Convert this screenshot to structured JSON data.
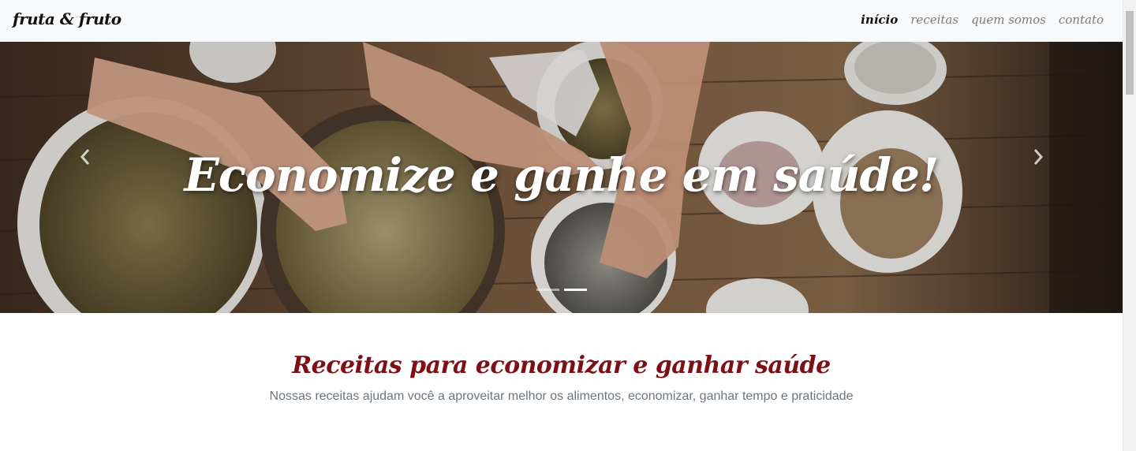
{
  "brand": {
    "name": "fruta & fruto"
  },
  "nav": {
    "items": [
      {
        "label": "início",
        "active": true
      },
      {
        "label": "receitas",
        "active": false
      },
      {
        "label": "quem somos",
        "active": false
      },
      {
        "label": "contato",
        "active": false
      }
    ]
  },
  "hero": {
    "caption": "Economize e ganhe em saúde!",
    "prev_icon": "chevron-left-icon",
    "next_icon": "chevron-right-icon",
    "indicators": [
      {
        "active": false
      },
      {
        "active": true
      }
    ]
  },
  "section": {
    "title": "Receitas para economizar e ganhar saúde",
    "subtitle": "Nossas receitas ajudam você a aproveitar melhor os alimentos, economizar, ganhar tempo e praticidade"
  },
  "colors": {
    "accent": "#7d0f15",
    "navbar_bg": "#f8f9fa",
    "muted_text": "#6c757d"
  }
}
